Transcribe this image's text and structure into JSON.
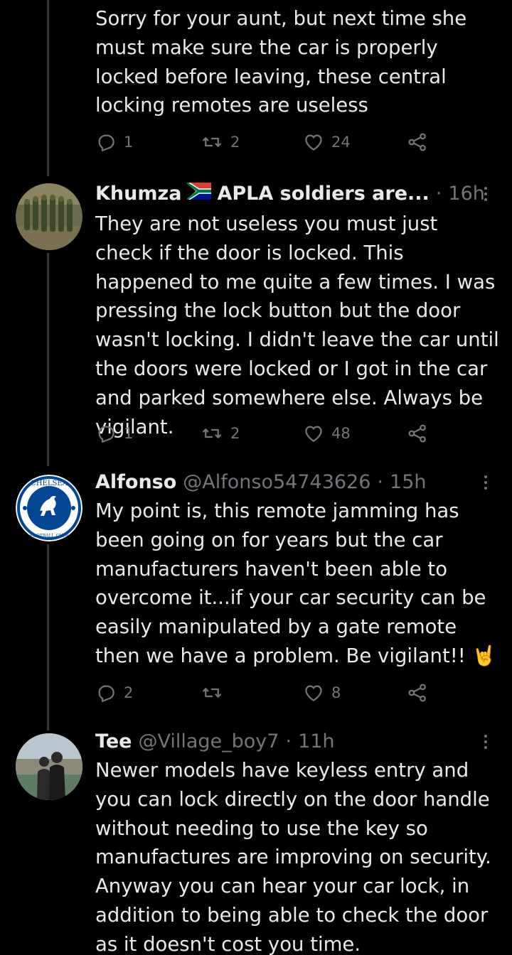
{
  "colors": {
    "background": "#000000",
    "text_primary": "#e7e9ea",
    "text_secondary": "#71767b",
    "thread_line": "#333639"
  },
  "tweets": [
    {
      "text": "Sorry for your aunt, but next time she must make sure the car is properly locked before leaving, these central locking remotes are useless",
      "actions": {
        "replies": "1",
        "retweets": "2",
        "likes": "24"
      }
    },
    {
      "name": "Khumza",
      "flag_icon": "south-africa-flag-icon",
      "handle": "APLA soldiers are...",
      "separator": "·",
      "time": "16h",
      "text": "They are not useless you must just check if the door is locked. This happened to me quite a few times. I was pressing the lock button but the door wasn't locking. I didn't leave the car until the doors were locked or I got in the car and parked somewhere else. Always be vigilant.",
      "actions": {
        "replies": "1",
        "retweets": "2",
        "likes": "48"
      }
    },
    {
      "name": "Alfonso",
      "handle": "@Alfonso54743626",
      "separator": "·",
      "time": "15h",
      "text": "My point is, this remote jamming has been going on for years but the car manufacturers haven't been able to overcome it...if your car security can be easily manipulated by a gate remote then we have a problem. Be vigilant!! 🤘",
      "actions": {
        "replies": "2",
        "retweets": "",
        "likes": "8"
      }
    },
    {
      "name": "Tee",
      "handle": "@Village_boy7",
      "separator": "·",
      "time": "11h",
      "text": "Newer models have keyless entry and you can lock directly on the door handle without needing to use the key so manufactures are improving on security. Anyway you can hear your car lock, in addition to being able to check the door as it doesn't cost you time."
    }
  ]
}
